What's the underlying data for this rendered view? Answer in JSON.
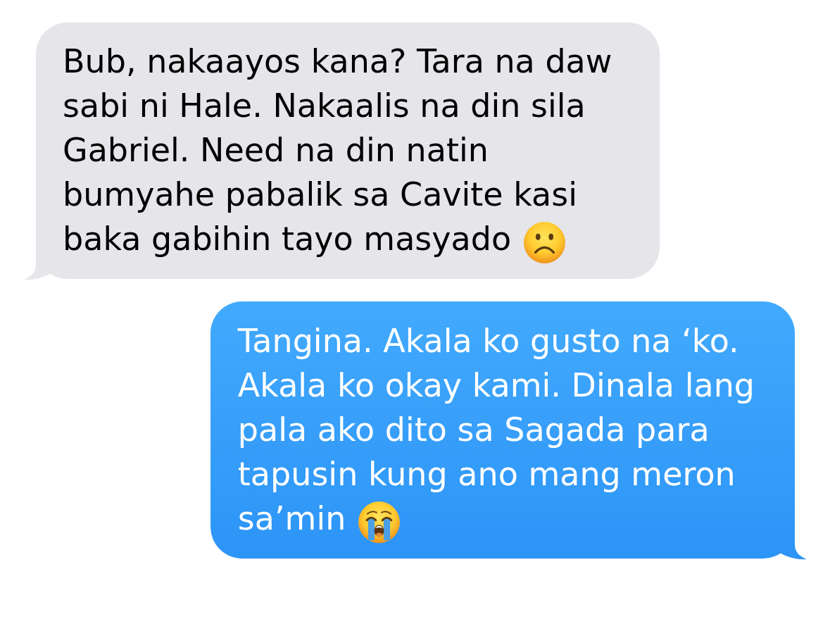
{
  "messages": [
    {
      "kind": "received",
      "lines": [
        "Bub, nakaayos kana? Tara na daw",
        "sabi ni Hale. Nakaalis na din sila",
        "Gabriel. Need na din natin",
        "bumyahe pabalik sa Cavite kasi",
        "baka gabihin tayo masyado"
      ]
    },
    {
      "kind": "sent",
      "lines": [
        "Tangina. Akala ko gusto na ‘ko.",
        "Akala ko okay kami. Dinala lang",
        "pala ako dito sa Sagada para",
        "tapusin kung ano mang meron",
        "sa’min"
      ]
    }
  ]
}
